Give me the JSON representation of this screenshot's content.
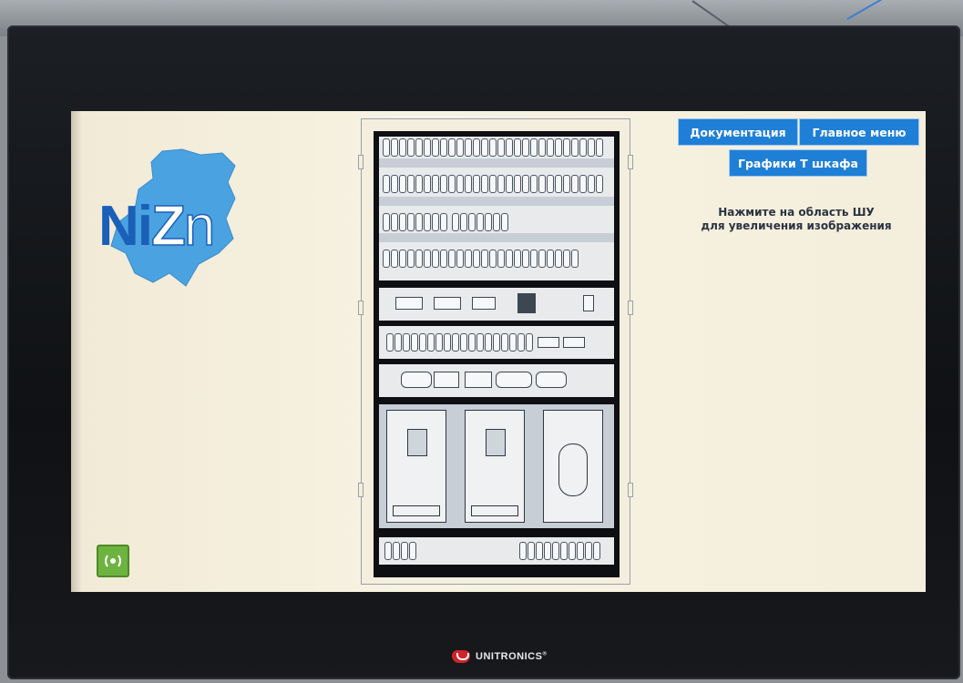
{
  "screen": {
    "brand": {
      "n1": "N",
      "i": "i",
      "z": "Z",
      "n2": "n"
    },
    "buttons": {
      "docs": "Документация",
      "main_menu": "Главное меню",
      "graphs": "Графики Т шкафа"
    },
    "hint": {
      "line1": "Нажмите на область ШУ",
      "line2": "для увеличения изображения"
    },
    "sound_icon": "speaker-icon"
  },
  "device": {
    "vendor": "UNITRONICS",
    "vendor_mark": "®"
  },
  "colors": {
    "button": "#1f7fd6",
    "brand": "#1a5fb8",
    "map": "#4aa3e0",
    "sound": "#6db33f",
    "vendor": "#d2232a"
  }
}
